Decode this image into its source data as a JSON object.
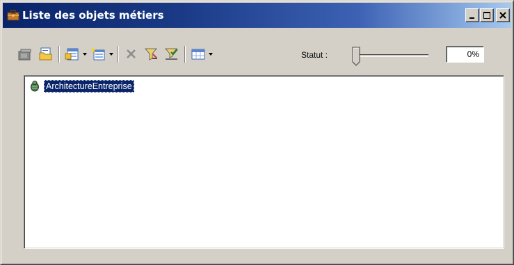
{
  "window": {
    "title": "Liste des objets métiers",
    "icon": "briefcase-icon",
    "buttons": {
      "minimize": "minimize-icon",
      "maximize": "maximize-icon",
      "close": "close-icon"
    }
  },
  "toolbar": {
    "icons": [
      "properties-icon",
      "open-icon",
      "add-objects-icon",
      "new-object-icon",
      "delete-icon",
      "filter-icon",
      "filter-clear-icon",
      "columns-icon"
    ],
    "status_label": "Statut :",
    "progress_value": 0,
    "progress_text": "0%"
  },
  "list": {
    "items": [
      {
        "label": "ArchitectureEntreprise",
        "icon": "business-object-icon",
        "selected": true
      }
    ]
  },
  "colors": {
    "titlebar_start": "#0a246a",
    "titlebar_end": "#a6caf0",
    "face": "#d4d0c8",
    "selection": "#0a246a"
  }
}
